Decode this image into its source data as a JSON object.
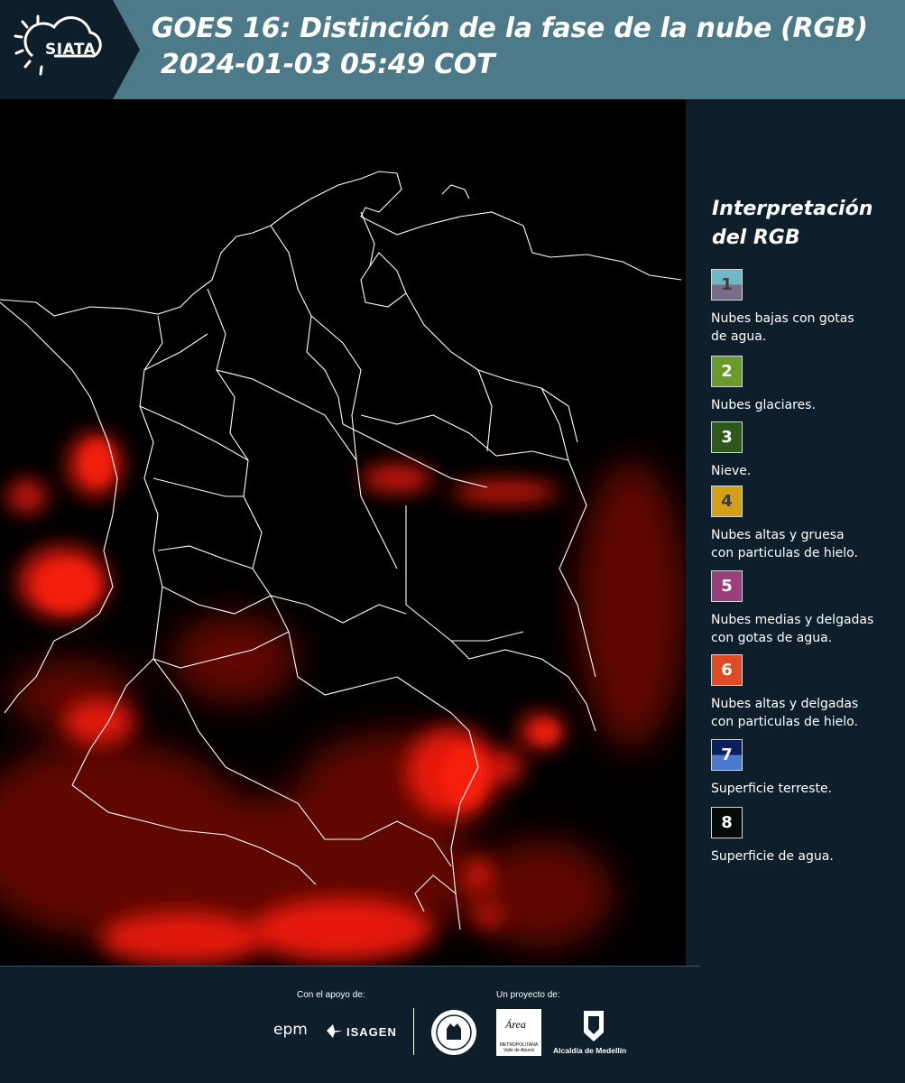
{
  "header": {
    "logo_text": "SIATA",
    "title_line1": "GOES 16: Distinción de la fase de la nube (RGB)",
    "title_line2": "2024-01-03 05:49 COT"
  },
  "legend": {
    "title_line1": "Interpretación",
    "title_line2": "del RGB",
    "items": [
      {
        "number": "1",
        "color_top": "#6fb7c3",
        "color_bottom": "#7a6b88",
        "desc_line1": "Nubes bajas con gotas",
        "desc_line2": "de agua."
      },
      {
        "number": "2",
        "color": "#6a9a2c",
        "desc_line1": "Nubes glaciares.",
        "desc_line2": ""
      },
      {
        "number": "3",
        "color": "#2d5a1b",
        "desc_line1": "Nieve.",
        "desc_line2": ""
      },
      {
        "number": "4",
        "color": "#d4a017",
        "desc_line1": "Nubes altas y gruesa",
        "desc_line2": "con particulas de hielo."
      },
      {
        "number": "5",
        "color": "#9b3f7a",
        "desc_line1": "Nubes medias y delgadas",
        "desc_line2": "con gotas de agua."
      },
      {
        "number": "6",
        "color": "#e04a25",
        "desc_line1": "Nubes altas y delgadas",
        "desc_line2": "con particulas de hielo."
      },
      {
        "number": "7",
        "color_top": "#0f1f5c",
        "color_bottom": "#4a7ad0",
        "desc_line1": "Superficie terreste.",
        "desc_line2": ""
      },
      {
        "number": "8",
        "color": "#050a05",
        "desc_line1": "Superficie de agua.",
        "desc_line2": ""
      }
    ]
  },
  "footer": {
    "support_label": "Con el apoyo de:",
    "project_label": "Un proyecto de:",
    "epm": "epm",
    "isagen": "ISAGEN",
    "area_logo": "Área",
    "area_sub": "METROPOLITANA Valle de Aburrá",
    "alcaldia": "Alcaldía de Medellín"
  },
  "colors": {
    "header_bg": "#4d7a88",
    "panel_bg": "#0e1e2a",
    "cloud_red": "#ff1a0a"
  }
}
